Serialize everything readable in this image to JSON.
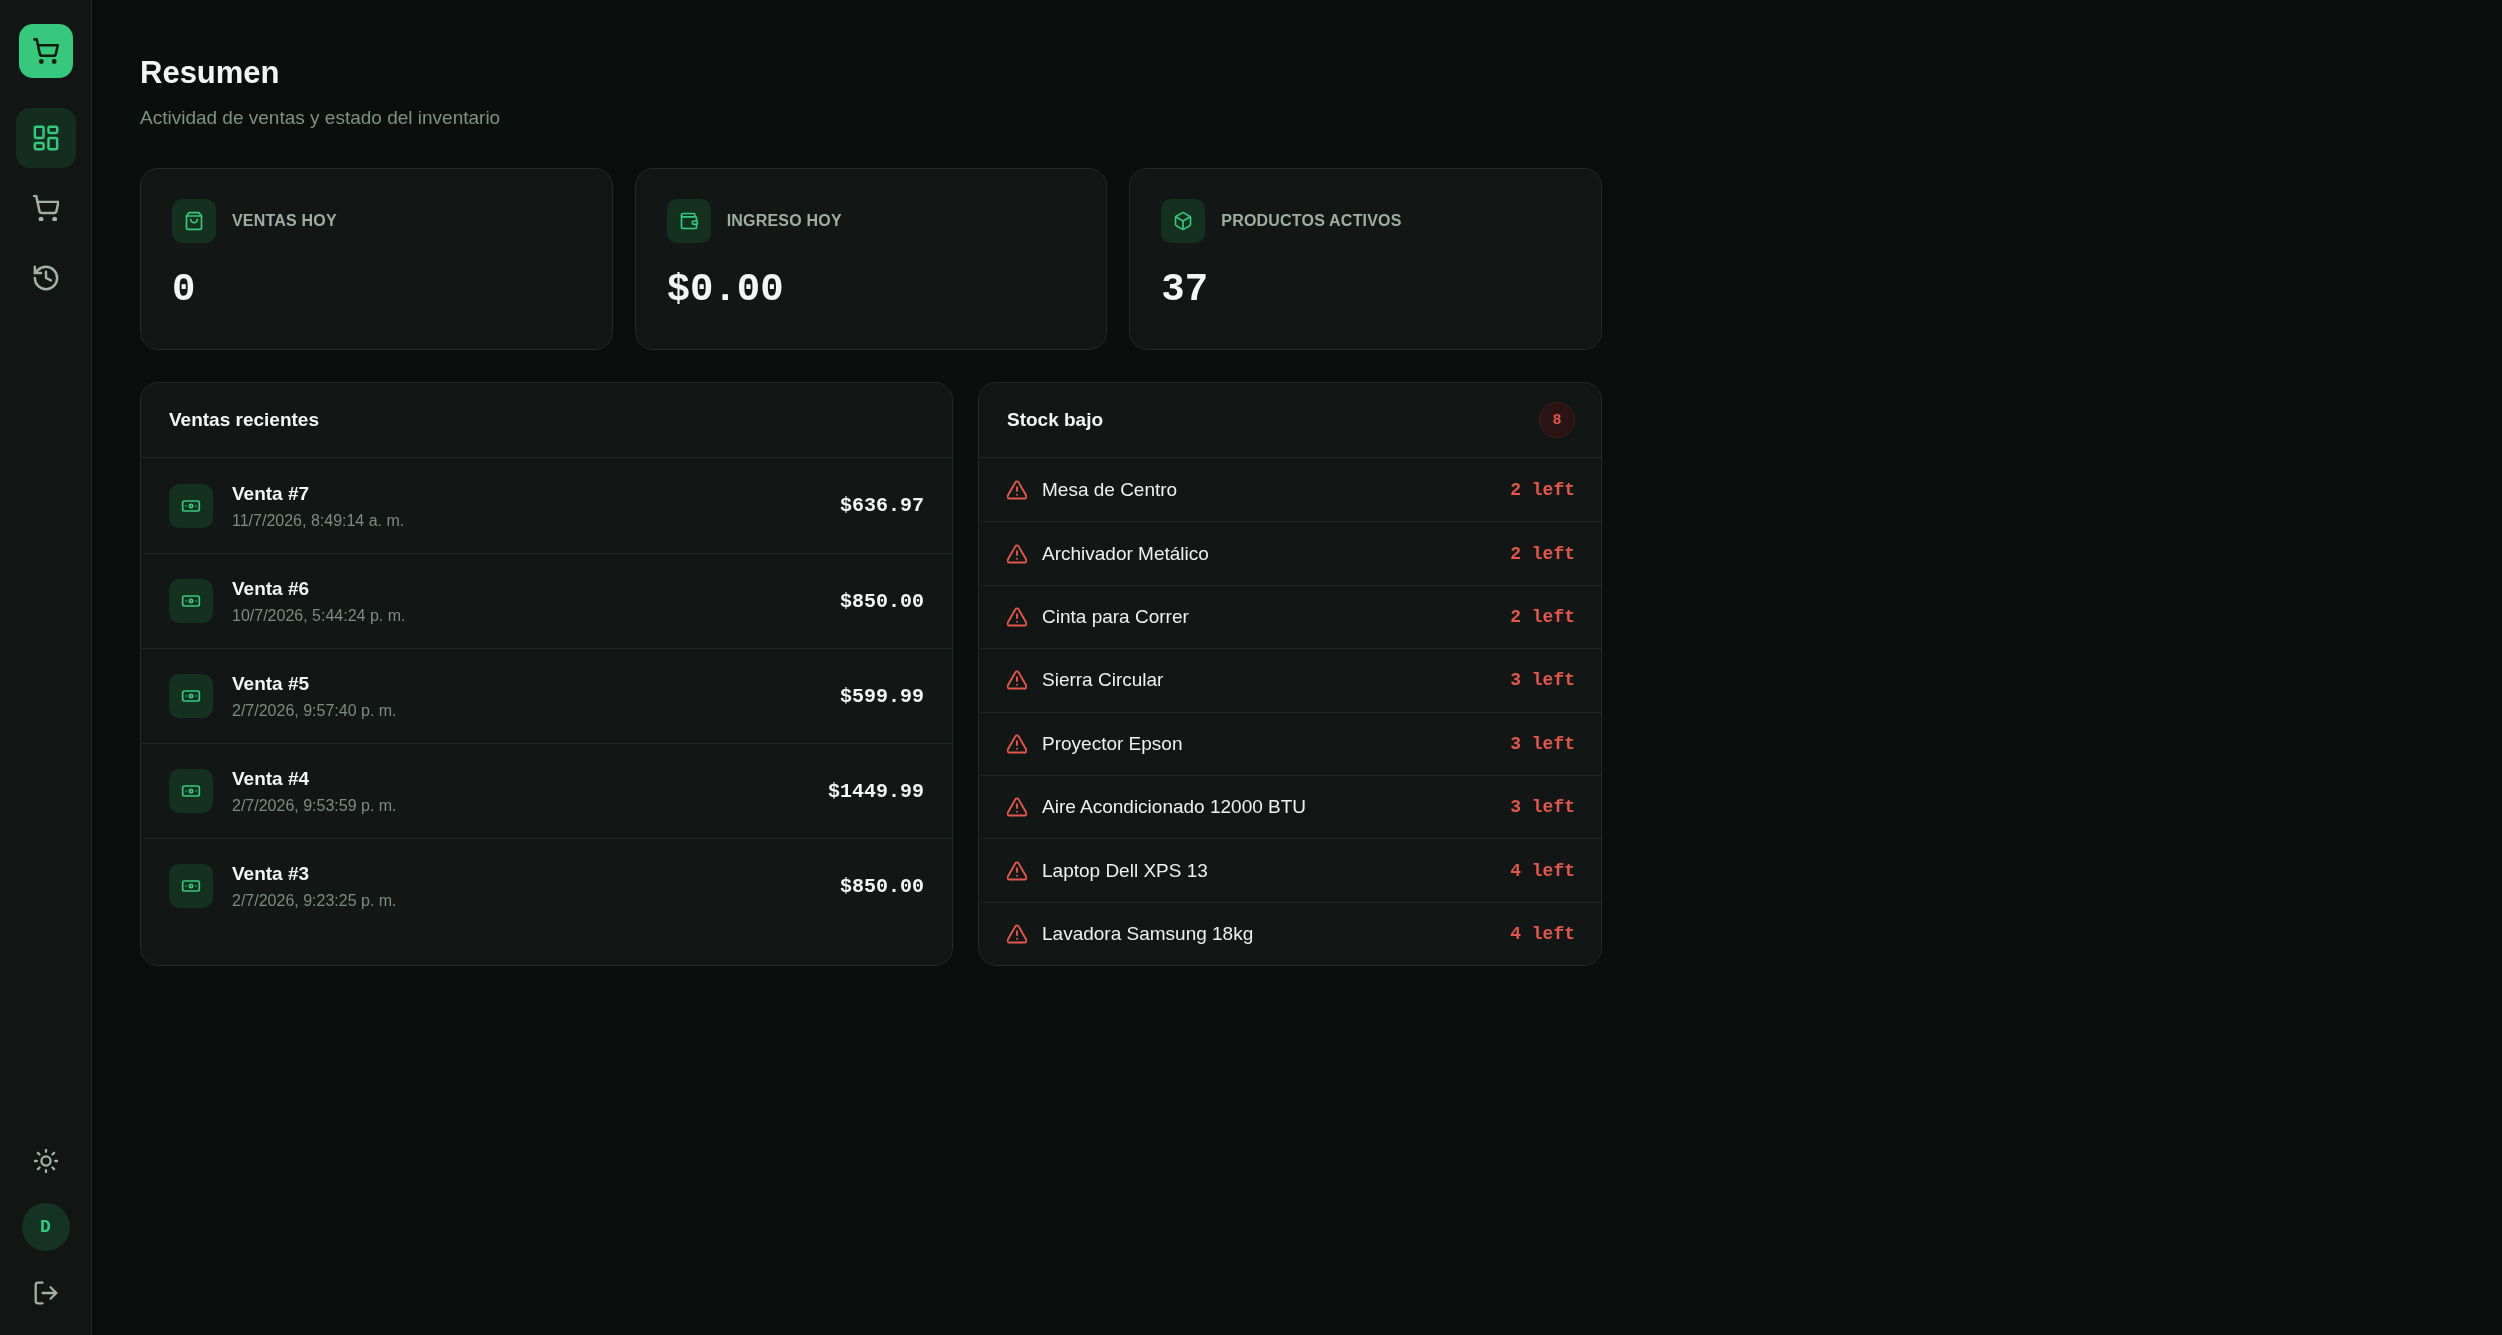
{
  "sidebar": {
    "nav": [
      {
        "selected": true
      },
      {
        "selected": false
      },
      {
        "selected": false
      }
    ],
    "avatar": "D"
  },
  "header": {
    "title": "Resumen",
    "subtitle": "Actividad de ventas y estado del inventario"
  },
  "stats": [
    {
      "label": "VENTAS HOY",
      "value": "0"
    },
    {
      "label": "INGRESO HOY",
      "value": "$0.00"
    },
    {
      "label": "PRODUCTOS ACTIVOS",
      "value": "37"
    }
  ],
  "recent_sales": {
    "title": "Ventas recientes",
    "rows": [
      {
        "name": "Venta #7",
        "date": "11/7/2026, 8:49:14 a. m.",
        "amount": "$636.97"
      },
      {
        "name": "Venta #6",
        "date": "10/7/2026, 5:44:24 p. m.",
        "amount": "$850.00"
      },
      {
        "name": "Venta #5",
        "date": "2/7/2026, 9:57:40 p. m.",
        "amount": "$599.99"
      },
      {
        "name": "Venta #4",
        "date": "2/7/2026, 9:53:59 p. m.",
        "amount": "$1449.99"
      },
      {
        "name": "Venta #3",
        "date": "2/7/2026, 9:23:25 p. m.",
        "amount": "$850.00"
      }
    ]
  },
  "low_stock": {
    "title": "Stock bajo",
    "count": "8",
    "items": [
      {
        "name": "Mesa de Centro",
        "remaining": "2 left"
      },
      {
        "name": "Archivador Metálico",
        "remaining": "2 left"
      },
      {
        "name": "Cinta para Correr",
        "remaining": "2 left"
      },
      {
        "name": "Sierra Circular",
        "remaining": "3 left"
      },
      {
        "name": "Proyector Epson",
        "remaining": "3 left"
      },
      {
        "name": "Aire Acondicionado 12000 BTU",
        "remaining": "3 left"
      },
      {
        "name": "Laptop Dell XPS 13",
        "remaining": "4 left"
      },
      {
        "name": "Lavadora Samsung 18kg",
        "remaining": "4 left"
      }
    ]
  }
}
